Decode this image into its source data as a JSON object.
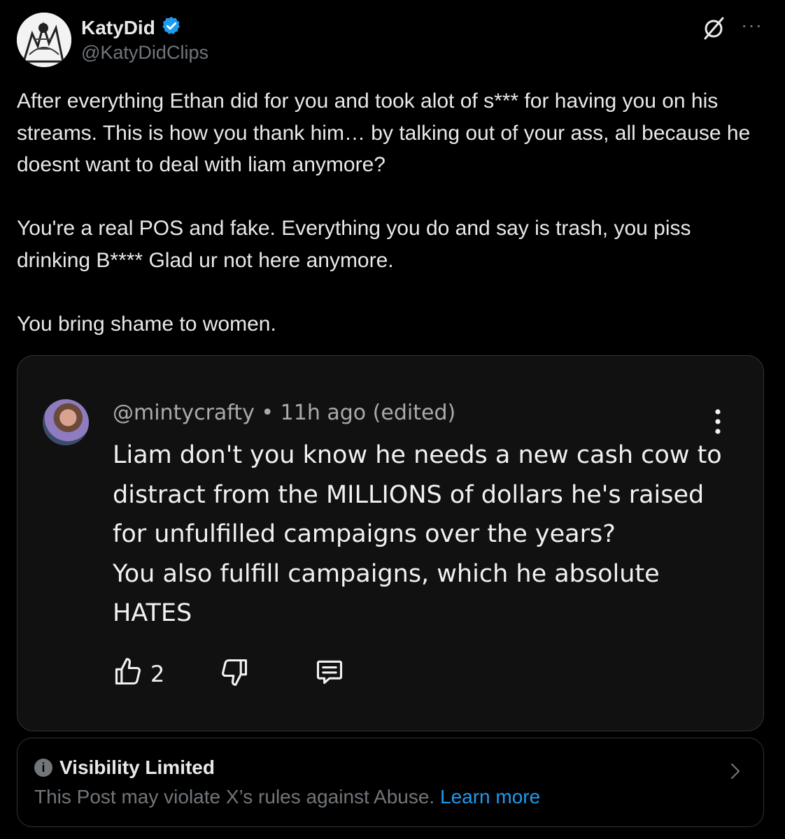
{
  "author": {
    "display_name": "KatyDid",
    "handle": "@KatyDidClips",
    "verified": true,
    "verified_color": "#1d9bf0"
  },
  "header_icons": [
    "grok-icon",
    "more-icon"
  ],
  "more_label": "···",
  "tweet": {
    "paragraphs": [
      "After everything Ethan did for you and took alot of s*** for having you on his streams. This is how you thank him… by talking out of your ass, all because he doesnt want to deal with liam anymore?",
      "You're a real POS and fake. Everything you do and say is trash, you piss drinking B**** Glad ur not here anymore.",
      "You bring shame to women."
    ]
  },
  "embedded_comment": {
    "username": "@mintycrafty",
    "separator": " • ",
    "time": "11h ago (edited)",
    "lines": [
      "Liam don't you know he needs a new cash cow to",
      "distract from the MILLIONS of dollars he's raised",
      "for unfulfilled campaigns over the years?",
      "You also fulfill campaigns, which he absolute",
      "HATES"
    ],
    "like_count": "2",
    "icons": [
      "thumbs-up-icon",
      "thumbs-down-icon",
      "reply-icon",
      "kebab-menu-icon"
    ]
  },
  "visibility_notice": {
    "title": "Visibility Limited",
    "text": "This Post may violate X’s rules against Abuse. ",
    "link": "Learn more",
    "link_color": "#1d9bf0"
  }
}
